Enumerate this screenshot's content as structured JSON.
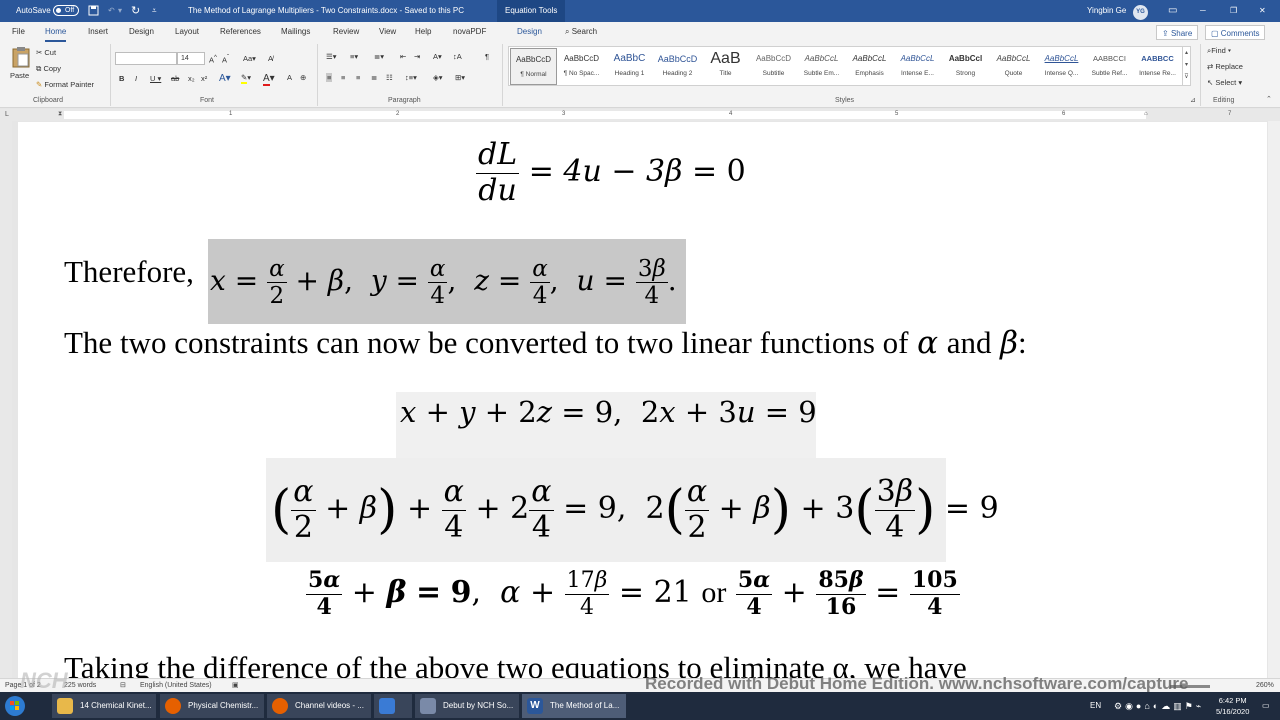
{
  "titlebar": {
    "autosave_label": "AutoSave",
    "autosave_state": "Off",
    "save_icon": "save-icon",
    "undo_icon": "undo-icon",
    "redo_icon": "redo-icon",
    "customize_glyph": "⩡",
    "document_title": "The Method of Lagrange Multipliers - Two Constraints.docx  -  Saved to this PC",
    "contextual_tab": "Equation Tools",
    "user_name": "Yingbin Ge",
    "user_initials": "YG",
    "ribbon_display_glyph": "▭",
    "minimize_glyph": "─",
    "restore_glyph": "❐",
    "close_glyph": "✕",
    "brand_color": "#2b579a"
  },
  "ribbon": {
    "tabs": [
      "File",
      "Home",
      "Insert",
      "Design",
      "Layout",
      "References",
      "Mailings",
      "Review",
      "View",
      "Help",
      "novaPDF",
      "Design"
    ],
    "active_tab": "Home",
    "search_label": "Search",
    "share_label": "Share",
    "comments_label": "Comments",
    "clipboard": {
      "paste": "Paste",
      "cut": "Cut",
      "copy": "Copy",
      "format_painter": "Format Painter",
      "group_label": "Clipboard"
    },
    "font": {
      "font_name": "",
      "font_size": "14",
      "group_label": "Font"
    },
    "paragraph": {
      "group_label": "Paragraph"
    },
    "styles": {
      "group_label": "Styles",
      "items": [
        {
          "preview": "AaBbCcD",
          "name": "¶ Normal"
        },
        {
          "preview": "AaBbCcD",
          "name": "¶ No Spac..."
        },
        {
          "preview": "AaBbC",
          "name": "Heading 1"
        },
        {
          "preview": "AaBbCcD",
          "name": "Heading 2"
        },
        {
          "preview": "AaB",
          "name": "Title"
        },
        {
          "preview": "AaBbCcD",
          "name": "Subtitle"
        },
        {
          "preview": "AaBbCcL",
          "name": "Subtle Em..."
        },
        {
          "preview": "AaBbCcL",
          "name": "Emphasis"
        },
        {
          "preview": "AaBbCcL",
          "name": "Intense E..."
        },
        {
          "preview": "AaBbCcl",
          "name": "Strong"
        },
        {
          "preview": "AaBbCcL",
          "name": "Quote"
        },
        {
          "preview": "AaBbCcL",
          "name": "Intense Q..."
        },
        {
          "preview": "AABBCCI",
          "name": "Subtle Ref..."
        },
        {
          "preview": "AABBCC",
          "name": "Intense Re..."
        }
      ]
    },
    "editing": {
      "find": "Find",
      "replace": "Replace",
      "select": "Select",
      "group_label": "Editing"
    }
  },
  "ruler": {
    "marks": [
      "1",
      "2",
      "3",
      "4",
      "5",
      "6",
      "7"
    ]
  },
  "document": {
    "therefore": "Therefore,",
    "constraints_sentence": "The two constraints can now be converted to two linear functions of",
    "alpha": "α",
    "and": "and",
    "beta": "β",
    "colon": ":",
    "or": "or",
    "partial_line": "Taking the difference of the above two equations to eliminate α, we have"
  },
  "statusbar": {
    "page": "Page 1 of 2",
    "words": "225 words",
    "language": "English (United States)",
    "zoom": "260%"
  },
  "watermark": "Recorded with Debut Home Edition. www.nchsoftware.com/capture",
  "taskbar": {
    "items": [
      {
        "label": "14 Chemical Kinet...",
        "icon": "folder-icon",
        "color": "#e8b84a"
      },
      {
        "label": "Physical Chemistr...",
        "icon": "firefox-icon",
        "color": "#e66000"
      },
      {
        "label": "Channel videos - ...",
        "icon": "firefox-icon",
        "color": "#e66000"
      },
      {
        "label": "",
        "icon": "remote-desktop-icon",
        "color": "#3a7bd5"
      },
      {
        "label": "Debut by NCH So...",
        "icon": "debut-icon",
        "color": "#7a8aa8"
      },
      {
        "label": "The Method of La...",
        "icon": "word-icon",
        "color": "#2b579a"
      }
    ],
    "input_language": "EN",
    "time": "6:42 PM",
    "date": "5/16/2020"
  }
}
